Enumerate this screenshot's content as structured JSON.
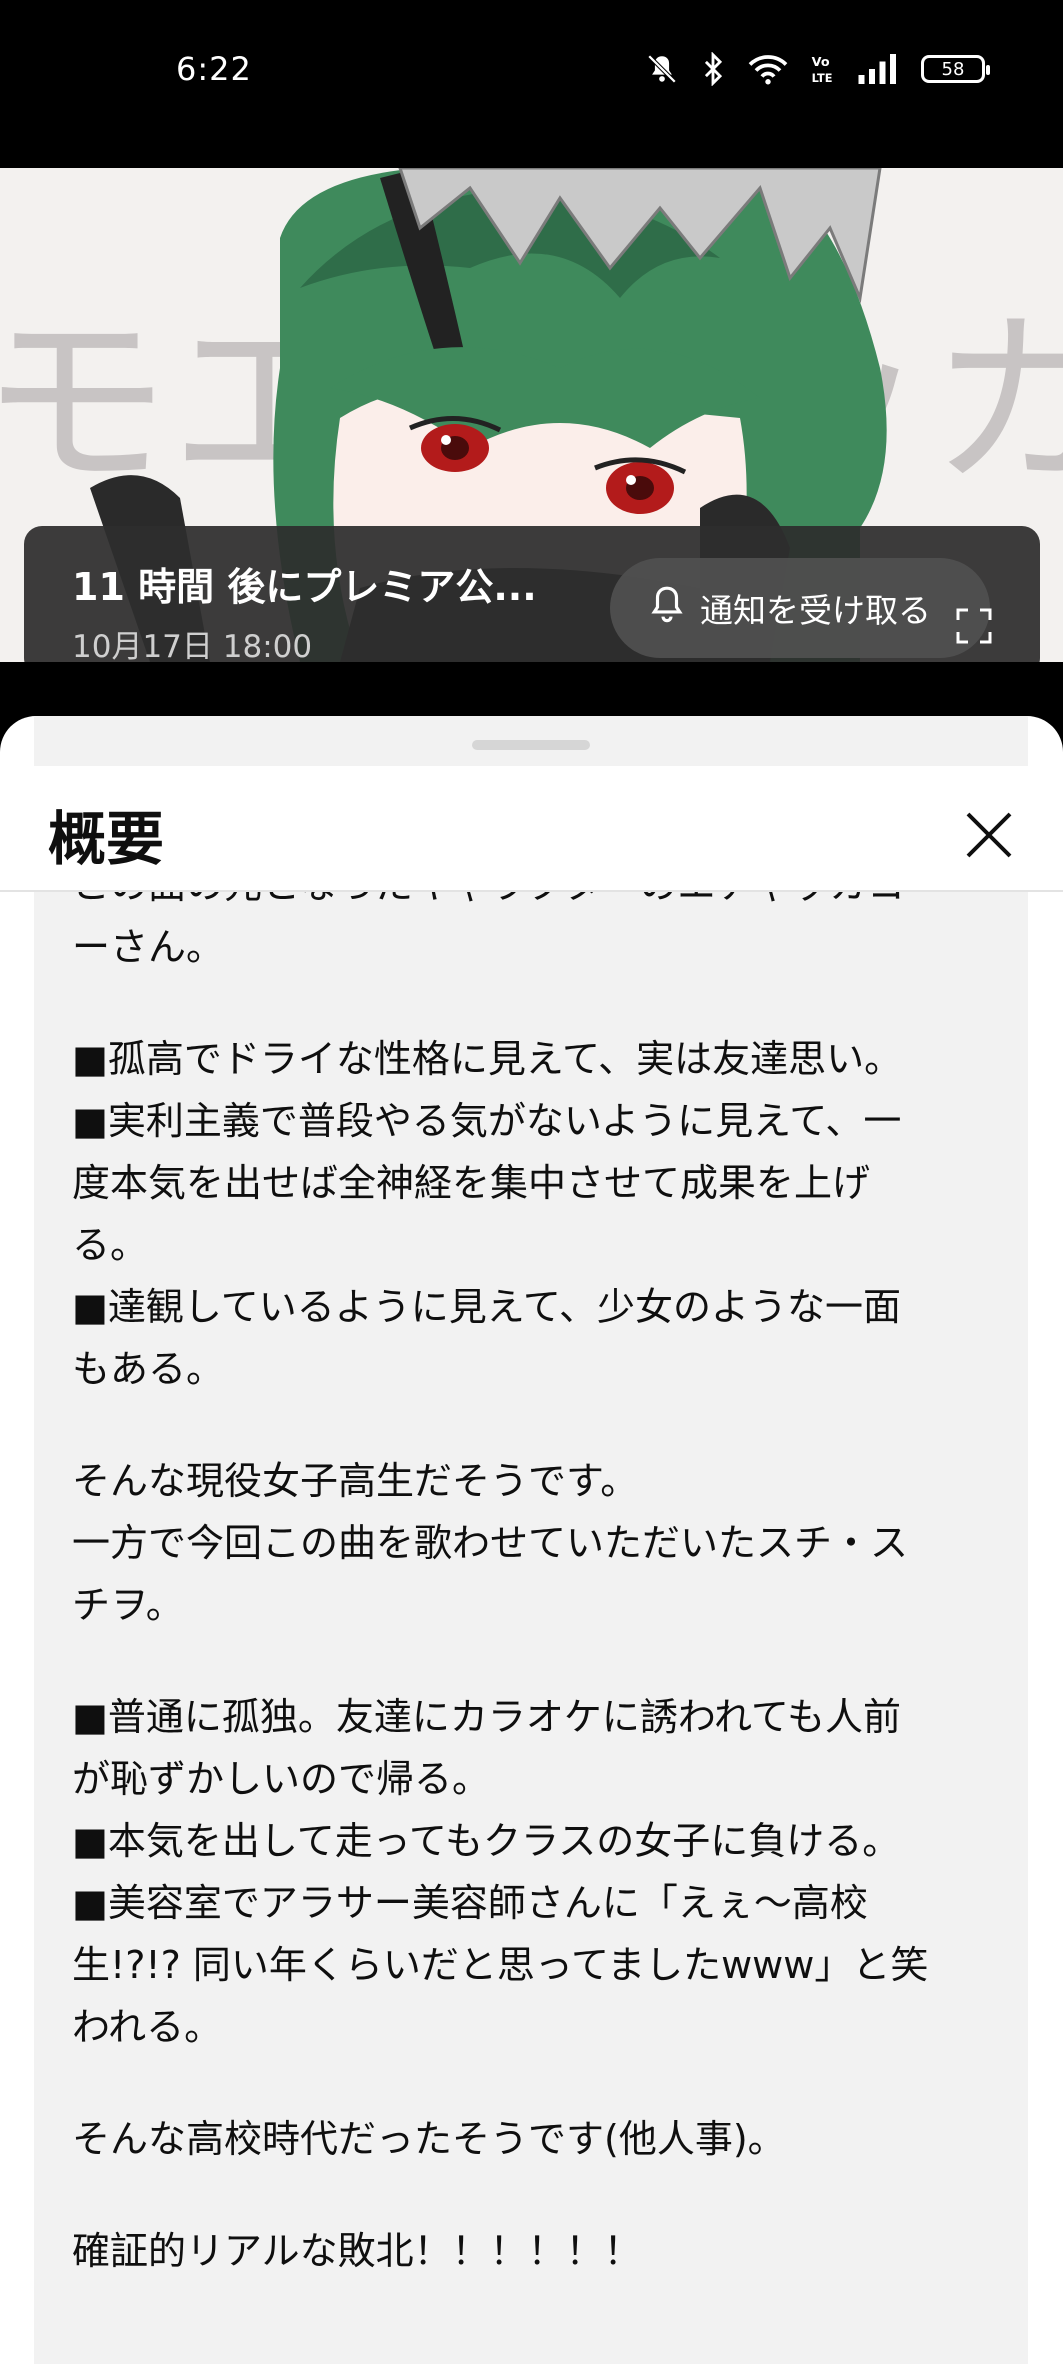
{
  "status_bar": {
    "time": "6:22",
    "battery": "58",
    "icons": [
      "mute-icon",
      "bluetooth-icon",
      "wifi-icon",
      "volte-icon",
      "signal-icon",
      "battery-icon"
    ]
  },
  "video": {
    "premiere_title": "11 時間 後にプレミア公...",
    "premiere_date": "10月17日 18:00",
    "notify_label": "通知を受け取る",
    "bg_text": "モエチャッカファイア"
  },
  "sheet": {
    "title": "概要"
  },
  "description": [
    "この曲の元となったキャラクターのエチャッカコ",
    "ーさん。",
    "",
    "■孤高でドライな性格に見えて、実は友達思い。",
    "■実利主義で普段やる気がないように見えて、一",
    "度本気を出せば全神経を集中させて成果を上げ",
    "る。",
    "■達観しているように見えて、少女のような一面",
    "もある。",
    "",
    "そんな現役女子高生だそうです。",
    "一方で今回この曲を歌わせていただいたスチ・ス",
    "チヲ。",
    "",
    "■普通に孤独。友達にカラオケに誘われても人前",
    "が恥ずかしいので帰る。",
    "■本気を出して走ってもクラスの女子に負ける。",
    "■美容室でアラサー美容師さんに「えぇ～高校",
    "生!?!? 同い年くらいだと思ってましたwww」と笑",
    "われる。",
    "",
    "そんな高校時代だったそうです(他人事)。",
    "",
    "確証的リアルな敗北！！！！！！"
  ]
}
